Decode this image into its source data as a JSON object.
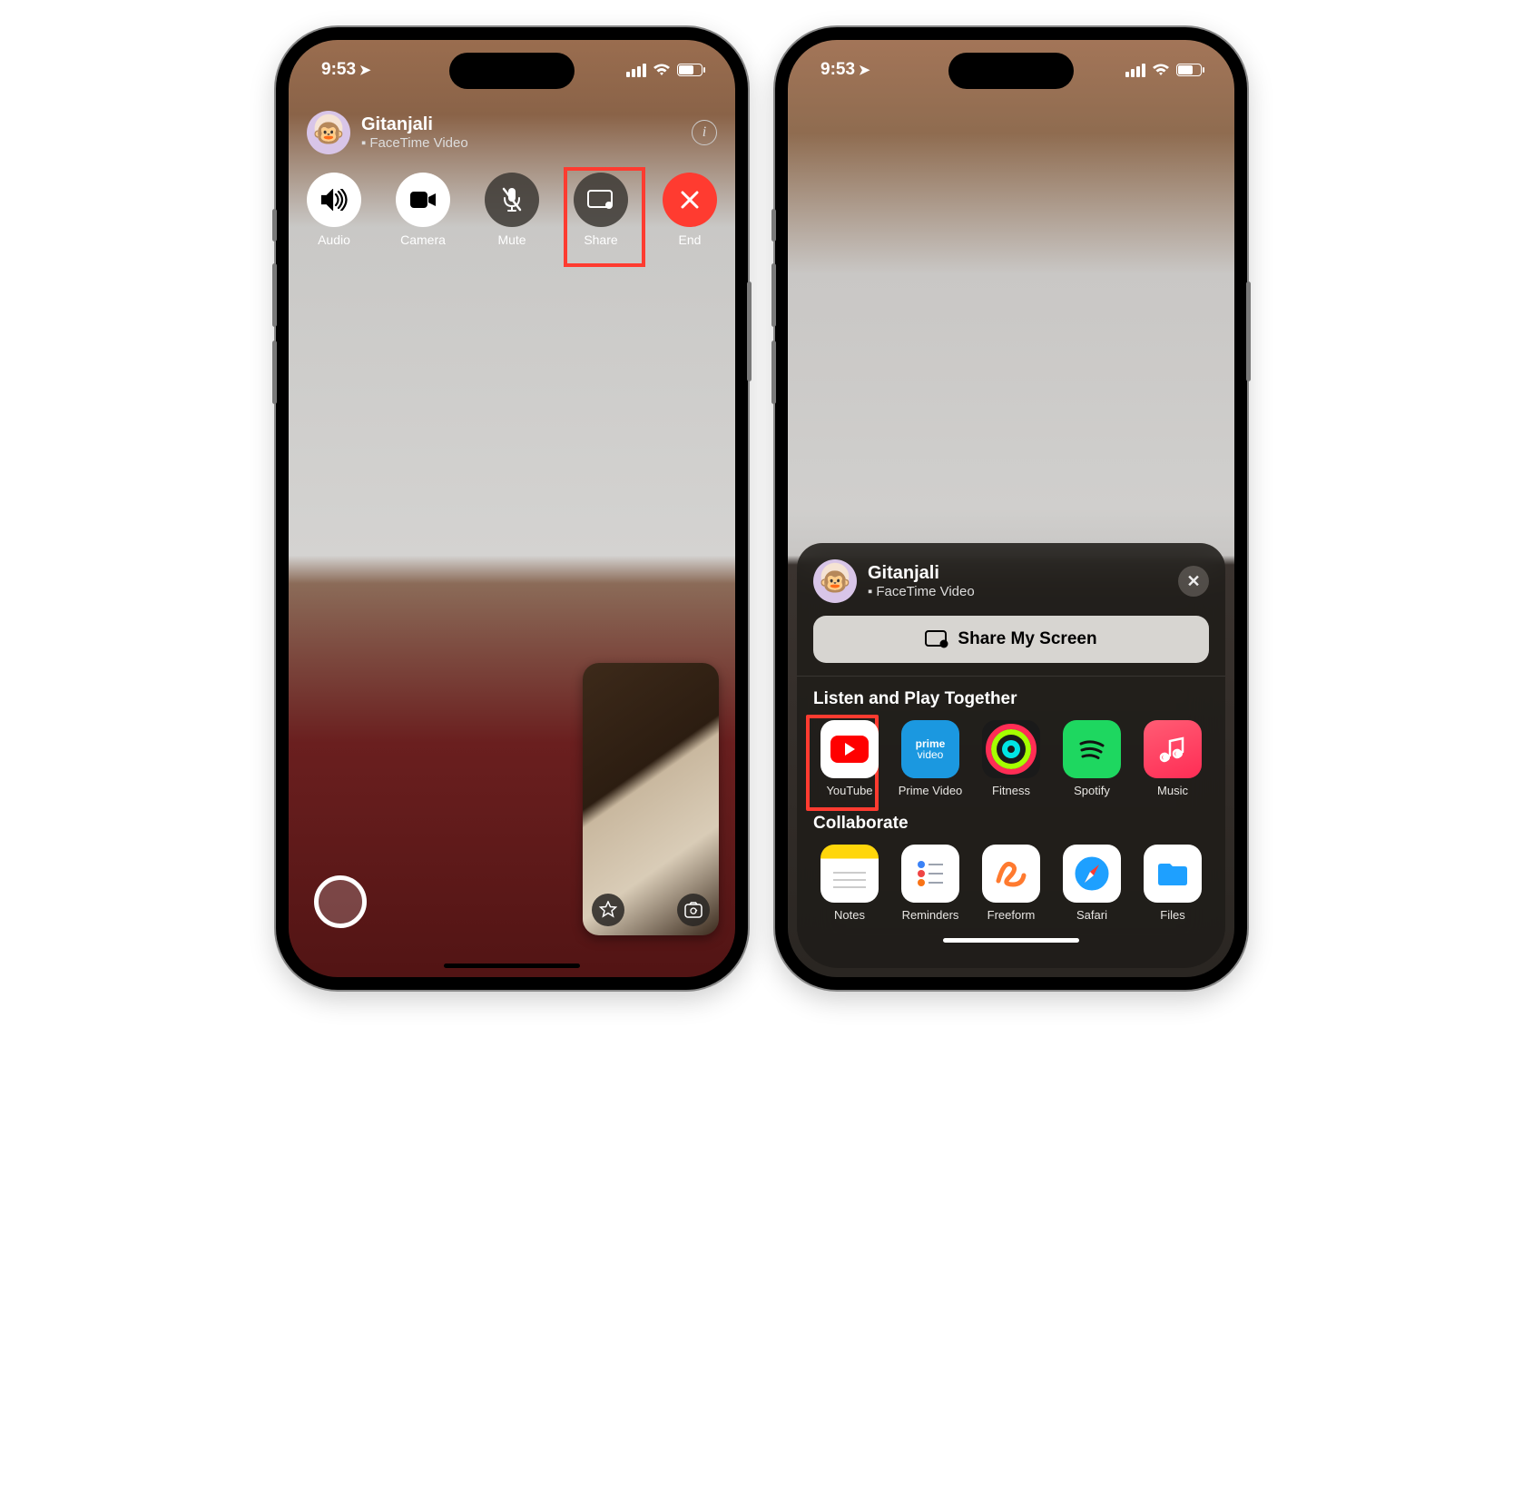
{
  "status": {
    "time": "9:53"
  },
  "left": {
    "caller_name": "Gitanjali",
    "call_type": "FaceTime Video",
    "controls": {
      "audio": "Audio",
      "camera": "Camera",
      "mute": "Mute",
      "share": "Share",
      "end": "End"
    }
  },
  "right": {
    "caller_name": "Gitanjali",
    "call_type": "FaceTime Video",
    "share_button": "Share My Screen",
    "section_listen": "Listen and Play Together",
    "section_collab": "Collaborate",
    "apps_listen": {
      "youtube": "YouTube",
      "prime": "Prime Video",
      "fitness": "Fitness",
      "spotify": "Spotify",
      "music": "Music"
    },
    "apps_collab": {
      "notes": "Notes",
      "reminders": "Reminders",
      "freeform": "Freeform",
      "safari": "Safari",
      "files": "Files"
    }
  }
}
